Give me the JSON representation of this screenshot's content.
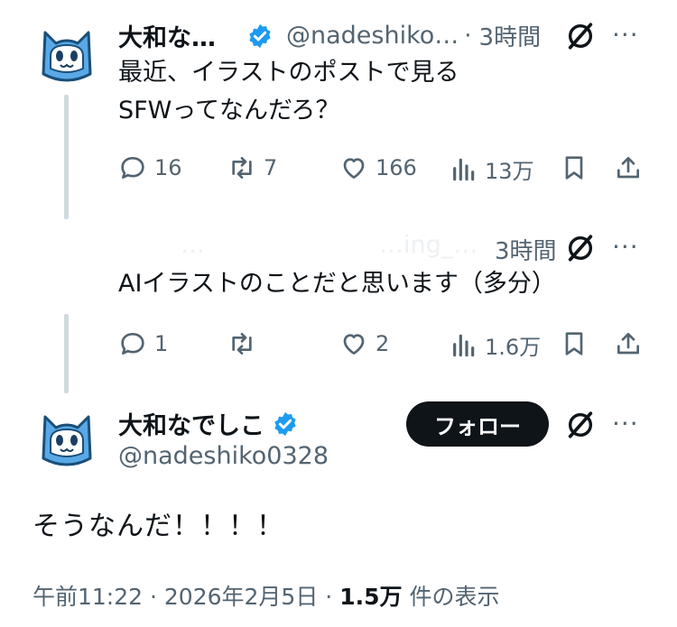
{
  "reply1": {
    "author_name": "大和な…",
    "handle": "@nadeshiko…",
    "separator": "·",
    "time": "3時間",
    "text_line1": "最近、イラストのポストで見る",
    "text_line2": "SFWってなんだろ？",
    "stats": {
      "replies": "16",
      "reposts": "7",
      "likes": "166",
      "views": "13万"
    }
  },
  "reply2": {
    "author_faded": "…",
    "handle_faded": "…ing_…",
    "time": "3時間",
    "text": "AIイラストのことだと思います（多分）",
    "stats": {
      "replies": "1",
      "likes": "2",
      "views": "1.6万"
    }
  },
  "main_post": {
    "author_name": "大和なでしこ",
    "handle": "@nadeshiko0328",
    "follow_label": "フォロー",
    "text": "そうなんだ！！！！",
    "time": "午前11:22",
    "sep1": "·",
    "date": "2026年2月5日",
    "sep2": "·",
    "views_count": "1.5万",
    "views_suffix": "件の表示"
  },
  "more_label": "···",
  "colors": {
    "verified": "#1d9bf0",
    "text": "#0f1419",
    "muted": "#536471",
    "line": "#cfd9de",
    "button": "#0f1419"
  },
  "icons": [
    "avatar-cat",
    "verified-badge-icon",
    "grok-icon",
    "more-icon",
    "reply-icon",
    "repost-icon",
    "like-icon",
    "views-icon",
    "bookmark-icon",
    "share-icon"
  ]
}
